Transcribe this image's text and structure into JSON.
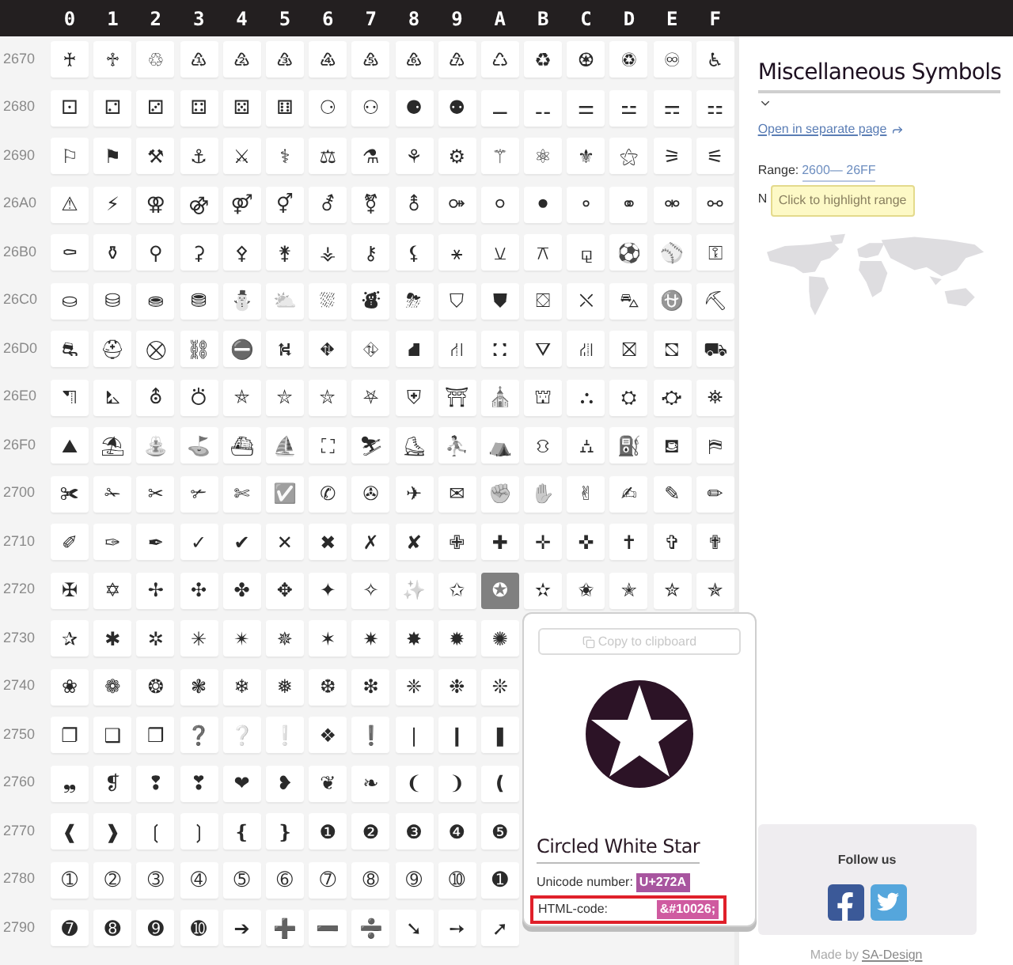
{
  "header": {
    "columns": [
      "0",
      "1",
      "2",
      "3",
      "4",
      "5",
      "6",
      "7",
      "8",
      "9",
      "A",
      "B",
      "C",
      "D",
      "E",
      "F"
    ]
  },
  "rows": [
    {
      "label": "2670",
      "cells": [
        {
          "symbol": "♰",
          "selected": false
        },
        {
          "symbol": "♱",
          "selected": false
        },
        {
          "symbol": "♲",
          "selected": false
        },
        {
          "symbol": "♳",
          "selected": false
        },
        {
          "symbol": "♴",
          "selected": false
        },
        {
          "symbol": "♵",
          "selected": false
        },
        {
          "symbol": "♶",
          "selected": false
        },
        {
          "symbol": "♷",
          "selected": false
        },
        {
          "symbol": "♸",
          "selected": false
        },
        {
          "symbol": "♹",
          "selected": false
        },
        {
          "symbol": "♺",
          "selected": false
        },
        {
          "symbol": "♻",
          "selected": false
        },
        {
          "symbol": "♼",
          "selected": false
        },
        {
          "symbol": "♽",
          "selected": false
        },
        {
          "symbol": "♾",
          "selected": false
        },
        {
          "symbol": "♿",
          "selected": false
        }
      ]
    },
    {
      "label": "2680",
      "cells": [
        {
          "symbol": "⚀",
          "selected": false
        },
        {
          "symbol": "⚁",
          "selected": false
        },
        {
          "symbol": "⚂",
          "selected": false
        },
        {
          "symbol": "⚃",
          "selected": false
        },
        {
          "symbol": "⚄",
          "selected": false
        },
        {
          "symbol": "⚅",
          "selected": false
        },
        {
          "symbol": "⚆",
          "selected": false
        },
        {
          "symbol": "⚇",
          "selected": false
        },
        {
          "symbol": "⚈",
          "selected": false
        },
        {
          "symbol": "⚉",
          "selected": false
        },
        {
          "symbol": "⚊",
          "selected": false
        },
        {
          "symbol": "⚋",
          "selected": false
        },
        {
          "symbol": "⚌",
          "selected": false
        },
        {
          "symbol": "⚍",
          "selected": false
        },
        {
          "symbol": "⚎",
          "selected": false
        },
        {
          "symbol": "⚏",
          "selected": false
        }
      ]
    },
    {
      "label": "2690",
      "cells": [
        {
          "symbol": "⚐",
          "selected": false
        },
        {
          "symbol": "⚑",
          "selected": false
        },
        {
          "symbol": "⚒",
          "selected": false
        },
        {
          "symbol": "⚓",
          "selected": false
        },
        {
          "symbol": "⚔",
          "selected": false
        },
        {
          "symbol": "⚕",
          "selected": false
        },
        {
          "symbol": "⚖",
          "selected": false
        },
        {
          "symbol": "⚗",
          "selected": false
        },
        {
          "symbol": "⚘",
          "selected": false
        },
        {
          "symbol": "⚙",
          "selected": false
        },
        {
          "symbol": "⚚",
          "selected": false
        },
        {
          "symbol": "⚛",
          "selected": false
        },
        {
          "symbol": "⚜",
          "selected": false
        },
        {
          "symbol": "⚝",
          "selected": false
        },
        {
          "symbol": "⚞",
          "selected": false
        },
        {
          "symbol": "⚟",
          "selected": false
        }
      ]
    },
    {
      "label": "26A0",
      "cells": [
        {
          "symbol": "⚠",
          "selected": false
        },
        {
          "symbol": "⚡",
          "selected": false
        },
        {
          "symbol": "⚢",
          "selected": false
        },
        {
          "symbol": "⚣",
          "selected": false
        },
        {
          "symbol": "⚤",
          "selected": false
        },
        {
          "symbol": "⚥",
          "selected": false
        },
        {
          "symbol": "⚦",
          "selected": false
        },
        {
          "symbol": "⚧",
          "selected": false
        },
        {
          "symbol": "⚨",
          "selected": false
        },
        {
          "symbol": "⚩",
          "selected": false
        },
        {
          "symbol": "⚪",
          "selected": false
        },
        {
          "symbol": "⚫",
          "selected": false
        },
        {
          "symbol": "⚬",
          "selected": false
        },
        {
          "symbol": "⚭",
          "selected": false
        },
        {
          "symbol": "⚮",
          "selected": false
        },
        {
          "symbol": "⚯",
          "selected": false
        }
      ]
    },
    {
      "label": "26B0",
      "cells": [
        {
          "symbol": "⚰",
          "selected": false
        },
        {
          "symbol": "⚱",
          "selected": false
        },
        {
          "symbol": "⚲",
          "selected": false
        },
        {
          "symbol": "⚳",
          "selected": false
        },
        {
          "symbol": "⚴",
          "selected": false
        },
        {
          "symbol": "⚵",
          "selected": false
        },
        {
          "symbol": "⚶",
          "selected": false
        },
        {
          "symbol": "⚷",
          "selected": false
        },
        {
          "symbol": "⚸",
          "selected": false
        },
        {
          "symbol": "⚹",
          "selected": false
        },
        {
          "symbol": "⚺",
          "selected": false
        },
        {
          "symbol": "⚻",
          "selected": false
        },
        {
          "symbol": "⚼",
          "selected": false
        },
        {
          "symbol": "⚽",
          "selected": false
        },
        {
          "symbol": "⚾",
          "selected": false
        },
        {
          "symbol": "⚿",
          "selected": false
        }
      ]
    },
    {
      "label": "26C0",
      "cells": [
        {
          "symbol": "⛀",
          "selected": false
        },
        {
          "symbol": "⛁",
          "selected": false
        },
        {
          "symbol": "⛂",
          "selected": false
        },
        {
          "symbol": "⛃",
          "selected": false
        },
        {
          "symbol": "⛄",
          "selected": false
        },
        {
          "symbol": "⛅",
          "selected": false
        },
        {
          "symbol": "⛆",
          "selected": false
        },
        {
          "symbol": "⛇",
          "selected": false
        },
        {
          "symbol": "⛈",
          "selected": false
        },
        {
          "symbol": "⛉",
          "selected": false
        },
        {
          "symbol": "⛊",
          "selected": false
        },
        {
          "symbol": "⛋",
          "selected": false
        },
        {
          "symbol": "⛌",
          "selected": false
        },
        {
          "symbol": "⛍",
          "selected": false
        },
        {
          "symbol": "⛎",
          "selected": false
        },
        {
          "symbol": "⛏",
          "selected": false
        }
      ]
    },
    {
      "label": "26D0",
      "cells": [
        {
          "symbol": "⛐",
          "selected": false
        },
        {
          "symbol": "⛑",
          "selected": false
        },
        {
          "symbol": "⛒",
          "selected": false
        },
        {
          "symbol": "⛓",
          "selected": false
        },
        {
          "symbol": "⛔",
          "selected": false
        },
        {
          "symbol": "⛕",
          "selected": false
        },
        {
          "symbol": "⛖",
          "selected": false
        },
        {
          "symbol": "⛗",
          "selected": false
        },
        {
          "symbol": "⛘",
          "selected": false
        },
        {
          "symbol": "⛙",
          "selected": false
        },
        {
          "symbol": "⛚",
          "selected": false
        },
        {
          "symbol": "⛛",
          "selected": false
        },
        {
          "symbol": "⛜",
          "selected": false
        },
        {
          "symbol": "⛝",
          "selected": false
        },
        {
          "symbol": "⛞",
          "selected": false
        },
        {
          "symbol": "⛟",
          "selected": false
        }
      ]
    },
    {
      "label": "26E0",
      "cells": [
        {
          "symbol": "⛠",
          "selected": false
        },
        {
          "symbol": "⛡",
          "selected": false
        },
        {
          "symbol": "⛢",
          "selected": false
        },
        {
          "symbol": "⛣",
          "selected": false
        },
        {
          "symbol": "⛤",
          "selected": false
        },
        {
          "symbol": "⛥",
          "selected": false
        },
        {
          "symbol": "⛦",
          "selected": false
        },
        {
          "symbol": "⛧",
          "selected": false
        },
        {
          "symbol": "⛨",
          "selected": false
        },
        {
          "symbol": "⛩",
          "selected": false
        },
        {
          "symbol": "⛪",
          "selected": false
        },
        {
          "symbol": "⛫",
          "selected": false
        },
        {
          "symbol": "⛬",
          "selected": false
        },
        {
          "symbol": "⛭",
          "selected": false
        },
        {
          "symbol": "⛮",
          "selected": false
        },
        {
          "symbol": "⛯",
          "selected": false
        }
      ]
    },
    {
      "label": "26F0",
      "cells": [
        {
          "symbol": "⛰",
          "selected": false
        },
        {
          "symbol": "⛱",
          "selected": false
        },
        {
          "symbol": "⛲",
          "selected": false
        },
        {
          "symbol": "⛳",
          "selected": false
        },
        {
          "symbol": "⛴",
          "selected": false
        },
        {
          "symbol": "⛵",
          "selected": false
        },
        {
          "symbol": "⛶",
          "selected": false
        },
        {
          "symbol": "⛷",
          "selected": false
        },
        {
          "symbol": "⛸",
          "selected": false
        },
        {
          "symbol": "⛹",
          "selected": false
        },
        {
          "symbol": "⛺",
          "selected": false
        },
        {
          "symbol": "⛻",
          "selected": false
        },
        {
          "symbol": "⛼",
          "selected": false
        },
        {
          "symbol": "⛽",
          "selected": false
        },
        {
          "symbol": "⛾",
          "selected": false
        },
        {
          "symbol": "⛿",
          "selected": false
        }
      ]
    },
    {
      "label": "2700",
      "cells": [
        {
          "symbol": "✀",
          "selected": false
        },
        {
          "symbol": "✁",
          "selected": false
        },
        {
          "symbol": "✂",
          "selected": false
        },
        {
          "symbol": "✃",
          "selected": false
        },
        {
          "symbol": "✄",
          "selected": false
        },
        {
          "symbol": "✅",
          "selected": false
        },
        {
          "symbol": "✆",
          "selected": false
        },
        {
          "symbol": "✇",
          "selected": false
        },
        {
          "symbol": "✈",
          "selected": false
        },
        {
          "symbol": "✉",
          "selected": false
        },
        {
          "symbol": "✊",
          "selected": false
        },
        {
          "symbol": "✋",
          "selected": false
        },
        {
          "symbol": "✌",
          "selected": false
        },
        {
          "symbol": "✍",
          "selected": false
        },
        {
          "symbol": "✎",
          "selected": false
        },
        {
          "symbol": "✏",
          "selected": false
        }
      ]
    },
    {
      "label": "2710",
      "cells": [
        {
          "symbol": "✐",
          "selected": false
        },
        {
          "symbol": "✑",
          "selected": false
        },
        {
          "symbol": "✒",
          "selected": false
        },
        {
          "symbol": "✓",
          "selected": false
        },
        {
          "symbol": "✔",
          "selected": false
        },
        {
          "symbol": "✕",
          "selected": false
        },
        {
          "symbol": "✖",
          "selected": false
        },
        {
          "symbol": "✗",
          "selected": false
        },
        {
          "symbol": "✘",
          "selected": false
        },
        {
          "symbol": "✙",
          "selected": false
        },
        {
          "symbol": "✚",
          "selected": false
        },
        {
          "symbol": "✛",
          "selected": false
        },
        {
          "symbol": "✜",
          "selected": false
        },
        {
          "symbol": "✝",
          "selected": false
        },
        {
          "symbol": "✞",
          "selected": false
        },
        {
          "symbol": "✟",
          "selected": false
        }
      ]
    },
    {
      "label": "2720",
      "cells": [
        {
          "symbol": "✠",
          "selected": false
        },
        {
          "symbol": "✡",
          "selected": false
        },
        {
          "symbol": "✢",
          "selected": false
        },
        {
          "symbol": "✣",
          "selected": false
        },
        {
          "symbol": "✤",
          "selected": false
        },
        {
          "symbol": "✥",
          "selected": false
        },
        {
          "symbol": "✦",
          "selected": false
        },
        {
          "symbol": "✧",
          "selected": false
        },
        {
          "symbol": "✨",
          "selected": false
        },
        {
          "symbol": "✩",
          "selected": false
        },
        {
          "symbol": "✪",
          "selected": true
        },
        {
          "symbol": "✫",
          "selected": false
        },
        {
          "symbol": "✬",
          "selected": false
        },
        {
          "symbol": "✭",
          "selected": false
        },
        {
          "symbol": "✮",
          "selected": false
        },
        {
          "symbol": "✯",
          "selected": false
        }
      ]
    },
    {
      "label": "2730",
      "cells": [
        {
          "symbol": "✰",
          "selected": false
        },
        {
          "symbol": "✱",
          "selected": false
        },
        {
          "symbol": "✲",
          "selected": false
        },
        {
          "symbol": "✳",
          "selected": false
        },
        {
          "symbol": "✴",
          "selected": false
        },
        {
          "symbol": "✵",
          "selected": false
        },
        {
          "symbol": "✶",
          "selected": false
        },
        {
          "symbol": "✷",
          "selected": false
        },
        {
          "symbol": "✸",
          "selected": false
        },
        {
          "symbol": "✹",
          "selected": false
        },
        {
          "symbol": "✺",
          "selected": false
        }
      ]
    },
    {
      "label": "2740",
      "cells": [
        {
          "symbol": "❀",
          "selected": false
        },
        {
          "symbol": "❁",
          "selected": false
        },
        {
          "symbol": "❂",
          "selected": false
        },
        {
          "symbol": "❃",
          "selected": false
        },
        {
          "symbol": "❄",
          "selected": false
        },
        {
          "symbol": "❅",
          "selected": false
        },
        {
          "symbol": "❆",
          "selected": false
        },
        {
          "symbol": "❇",
          "selected": false
        },
        {
          "symbol": "❈",
          "selected": false
        },
        {
          "symbol": "❉",
          "selected": false
        },
        {
          "symbol": "❊",
          "selected": false
        }
      ]
    },
    {
      "label": "2750",
      "cells": [
        {
          "symbol": "❐",
          "selected": false
        },
        {
          "symbol": "❑",
          "selected": false
        },
        {
          "symbol": "❒",
          "selected": false
        },
        {
          "symbol": "❓",
          "selected": false
        },
        {
          "symbol": "❔",
          "selected": false
        },
        {
          "symbol": "❕",
          "selected": false
        },
        {
          "symbol": "❖",
          "selected": false
        },
        {
          "symbol": "❗",
          "selected": false
        },
        {
          "symbol": "❘",
          "selected": false
        },
        {
          "symbol": "❙",
          "selected": false
        },
        {
          "symbol": "❚",
          "selected": false
        }
      ]
    },
    {
      "label": "2760",
      "cells": [
        {
          "symbol": "❠",
          "selected": false
        },
        {
          "symbol": "❡",
          "selected": false
        },
        {
          "symbol": "❢",
          "selected": false
        },
        {
          "symbol": "❣",
          "selected": false
        },
        {
          "symbol": "❤",
          "selected": false
        },
        {
          "symbol": "❥",
          "selected": false
        },
        {
          "symbol": "❦",
          "selected": false
        },
        {
          "symbol": "❧",
          "selected": false
        },
        {
          "symbol": "❨",
          "selected": false
        },
        {
          "symbol": "❩",
          "selected": false
        },
        {
          "symbol": "❪",
          "selected": false
        }
      ]
    },
    {
      "label": "2770",
      "cells": [
        {
          "symbol": "❰",
          "selected": false
        },
        {
          "symbol": "❱",
          "selected": false
        },
        {
          "symbol": "❲",
          "selected": false
        },
        {
          "symbol": "❳",
          "selected": false
        },
        {
          "symbol": "❴",
          "selected": false
        },
        {
          "symbol": "❵",
          "selected": false
        },
        {
          "symbol": "❶",
          "selected": false
        },
        {
          "symbol": "❷",
          "selected": false
        },
        {
          "symbol": "❸",
          "selected": false
        },
        {
          "symbol": "❹",
          "selected": false
        },
        {
          "symbol": "❺",
          "selected": false
        }
      ]
    },
    {
      "label": "2780",
      "cells": [
        {
          "symbol": "➀",
          "selected": false
        },
        {
          "symbol": "➁",
          "selected": false
        },
        {
          "symbol": "➂",
          "selected": false
        },
        {
          "symbol": "➃",
          "selected": false
        },
        {
          "symbol": "➄",
          "selected": false
        },
        {
          "symbol": "➅",
          "selected": false
        },
        {
          "symbol": "➆",
          "selected": false
        },
        {
          "symbol": "➇",
          "selected": false
        },
        {
          "symbol": "➈",
          "selected": false
        },
        {
          "symbol": "➉",
          "selected": false
        },
        {
          "symbol": "➊",
          "selected": false
        }
      ]
    },
    {
      "label": "2790",
      "cells": [
        {
          "symbol": "➐",
          "selected": false
        },
        {
          "symbol": "➑",
          "selected": false
        },
        {
          "symbol": "➒",
          "selected": false
        },
        {
          "symbol": "➓",
          "selected": false
        },
        {
          "symbol": "➔",
          "selected": false
        },
        {
          "symbol": "➕",
          "selected": false
        },
        {
          "symbol": "➖",
          "selected": false
        },
        {
          "symbol": "➗",
          "selected": false
        },
        {
          "symbol": "➘",
          "selected": false
        },
        {
          "symbol": "➙",
          "selected": false
        },
        {
          "symbol": "➚",
          "selected": false
        }
      ]
    }
  ],
  "popup": {
    "copy_button": "Copy to clipboard",
    "name": "Circled White Star",
    "unicode_label": "Unicode number:",
    "unicode_value": "U+272A",
    "html_label": "HTML-code:",
    "html_value": "&#10026;"
  },
  "sidebar": {
    "title": "Miscellaneous Symbols",
    "link": "Open in separate page",
    "range_label": "Range:",
    "range_value": "2600— 26FF",
    "line_2": "N",
    "tooltip": "Click to highlight range",
    "follow_title": "Follow us",
    "credit_prefix": "Made by",
    "credit_link": "SA-Design"
  }
}
